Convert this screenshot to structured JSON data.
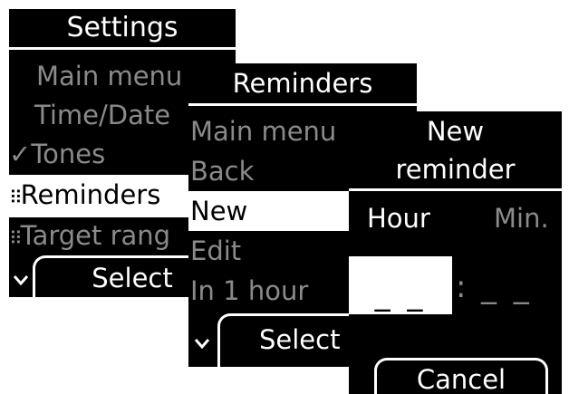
{
  "settings": {
    "title": "Settings",
    "items": [
      {
        "label": "Main menu"
      },
      {
        "label": "Time/Date"
      },
      {
        "label": "Tones",
        "mark": "✓"
      },
      {
        "label": "Reminders",
        "mark": "⠿"
      },
      {
        "label": "Target rang",
        "mark": "⠿"
      }
    ],
    "select_label": "Select"
  },
  "reminders": {
    "title": "Reminders",
    "items": [
      {
        "label": "Main menu"
      },
      {
        "label": "Back"
      },
      {
        "label": "New"
      },
      {
        "label": "Edit"
      },
      {
        "label": "In 1 hour"
      }
    ],
    "select_label": "Select"
  },
  "new_reminder": {
    "title_line1": "New",
    "title_line2": "reminder",
    "hour_label": "Hour",
    "min_label": "Min.",
    "hour_value": "_ _",
    "separator": ":",
    "min_value": "_ _",
    "cancel_label": "Cancel"
  },
  "colors": {
    "screen_bg": "#000000",
    "text": "#ffffff",
    "dim_text": "#8a8a8a",
    "highlight": "#ffffff"
  }
}
